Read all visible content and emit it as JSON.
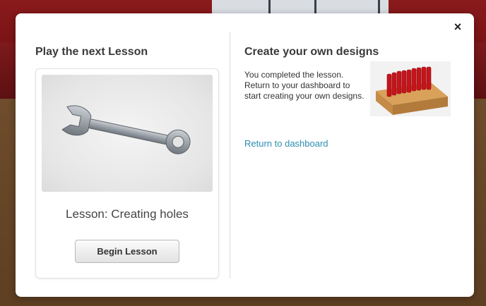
{
  "modal": {
    "close_glyph": "×",
    "left": {
      "title": "Play the next Lesson",
      "lesson_name": "Lesson: Creating holes",
      "begin_label": "Begin Lesson",
      "thumb_icon": "wrench-icon"
    },
    "right": {
      "title": "Create your own designs",
      "description": "You completed the lesson. Return to your dashboard to start creating your own designs.",
      "link_label": "Return to dashboard",
      "image_icon": "red-pegs-on-box-icon"
    }
  },
  "colors": {
    "link": "#2a8fb0",
    "title": "#3a3a3a"
  }
}
